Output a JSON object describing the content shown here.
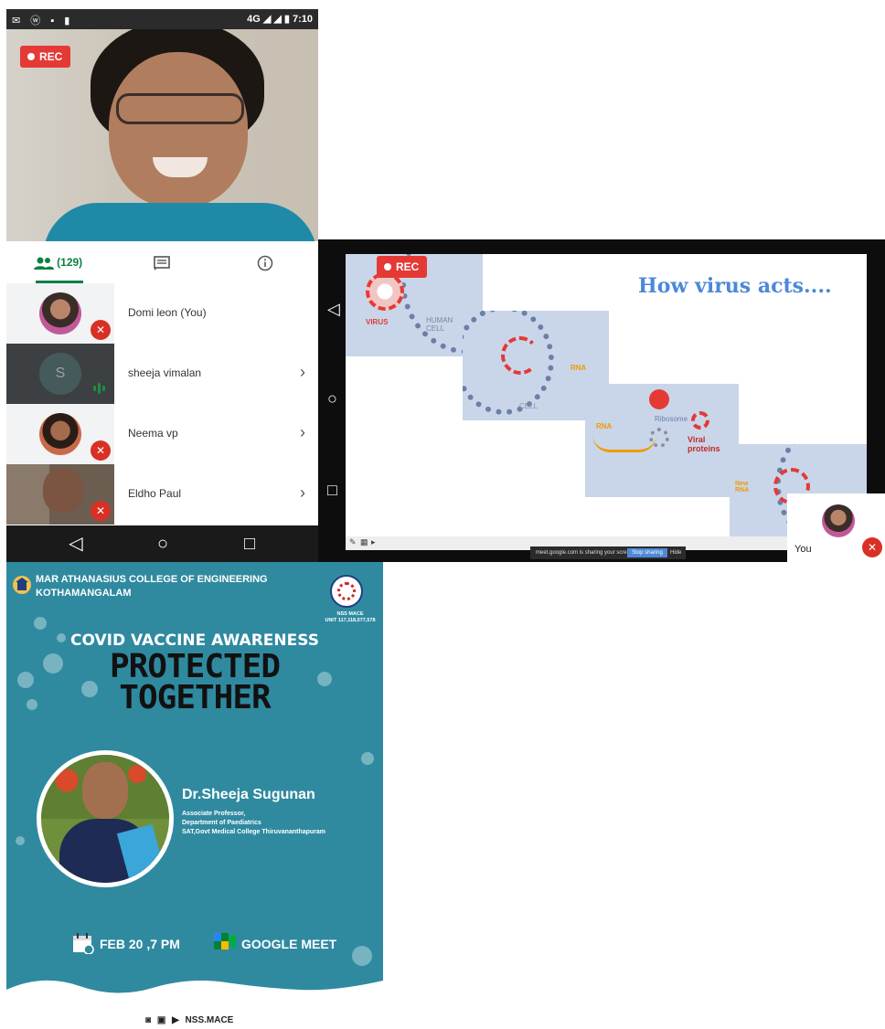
{
  "phone": {
    "status": {
      "left": "✉ ⓦ ▪ ▮",
      "right": "4G ◢ ◢ ▮ 7:10"
    },
    "rec_label": "REC",
    "tabs": {
      "people_count": "(129)"
    },
    "participants": [
      {
        "name": "Domi leon (You)",
        "muted": true
      },
      {
        "name": "sheeja vimalan",
        "initial": "S",
        "speaking": true
      },
      {
        "name": "Neema vp",
        "muted": true
      },
      {
        "name": "Eldho Paul",
        "muted": true
      }
    ]
  },
  "presentation": {
    "rec_label": "REC",
    "slide_title": "How virus acts....",
    "labels": {
      "virus": "VIRUS",
      "human_cell": "HUMAN CELL",
      "rna": "RNA",
      "cell": "CELL",
      "ribosome": "Ribosome",
      "rna2": "RNA",
      "viral_proteins": "Viral proteins",
      "new_rna": "New RNA"
    },
    "sharebar": {
      "text": "meet.google.com is sharing your screen.",
      "stop": "Stop sharing",
      "hide": "Hide"
    },
    "self_label": "You"
  },
  "poster": {
    "college_line1": "MAR ATHANASIUS COLLEGE OF ENGINEERING",
    "college_line2": "KOTHAMANGALAM",
    "nss_label": "NSS MACE",
    "nss_units": "UNIT 117,118,577,578",
    "subtitle": "COVID VACCINE AWARENESS",
    "title_line1": "PROTECTED",
    "title_line2": "TOGETHER",
    "speaker": "Dr.Sheeja Sugunan",
    "info1": "Associate Professor,",
    "info2": "Department of Paediatrics",
    "info3": "SAT,Govt Medical College Thiruvananthapuram",
    "date": "FEB 20 ,7 PM",
    "platform": "GOOGLE MEET",
    "footer": "NSS.MACE"
  },
  "colors": {
    "accent_green": "#0b8043",
    "rec_red": "#e53935",
    "poster_teal": "#2f8aa0",
    "slide_blue": "#4e88d6"
  }
}
